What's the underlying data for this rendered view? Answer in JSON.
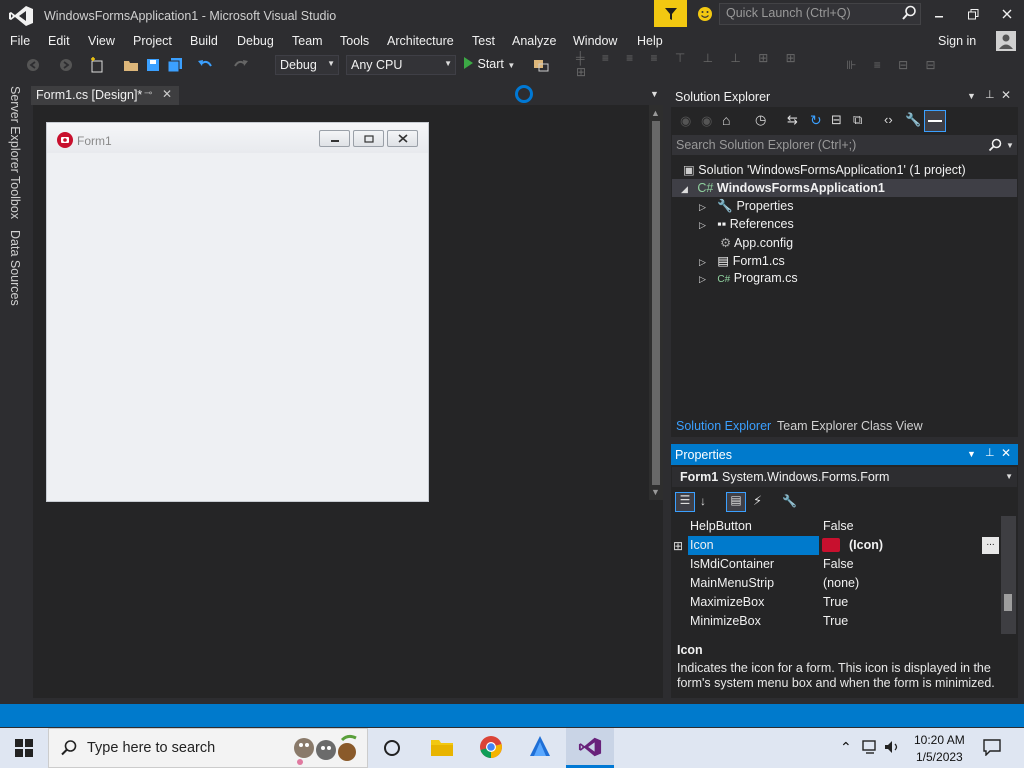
{
  "window": {
    "title": "WindowsFormsApplication1 - Microsoft Visual Studio",
    "quick_launch_placeholder": "Quick Launch (Ctrl+Q)"
  },
  "menu": {
    "items": [
      "File",
      "Edit",
      "View",
      "Project",
      "Build",
      "Debug",
      "Team",
      "Tools",
      "Architecture",
      "Test",
      "Analyze",
      "Window",
      "Help"
    ],
    "sign_in": "Sign in"
  },
  "toolbar": {
    "configuration": "Debug",
    "platform": "Any CPU",
    "start_label": "Start"
  },
  "left_rail": {
    "tabs": [
      "Server Explorer",
      "Toolbox",
      "Data Sources"
    ]
  },
  "document": {
    "tab_label": "Form1.cs [Design]*",
    "form_title": "Form1"
  },
  "solution_explorer": {
    "title": "Solution Explorer",
    "search_placeholder": "Search Solution Explorer (Ctrl+;)",
    "solution_label": "Solution 'WindowsFormsApplication1' (1 project)",
    "project_label": "WindowsFormsApplication1",
    "items": [
      "Properties",
      "References",
      "App.config",
      "Form1.cs",
      "Program.cs"
    ],
    "bottom_tabs": [
      "Solution Explorer",
      "Team Explorer",
      "Class View"
    ]
  },
  "properties": {
    "title": "Properties",
    "object_name": "Form1",
    "object_type": "System.Windows.Forms.Form",
    "rows": [
      {
        "name": "HelpButton",
        "value": "False"
      },
      {
        "name": "Icon",
        "value": "(Icon)"
      },
      {
        "name": "IsMdiContainer",
        "value": "False"
      },
      {
        "name": "MainMenuStrip",
        "value": "(none)"
      },
      {
        "name": "MaximizeBox",
        "value": "True"
      },
      {
        "name": "MinimizeBox",
        "value": "True"
      }
    ],
    "description_title": "Icon",
    "description_text": "Indicates the icon for a form. This icon is displayed in the form's system menu box and when the form is minimized."
  },
  "taskbar": {
    "search_placeholder": "Type here to search",
    "time": "10:20 AM",
    "date": "1/5/2023"
  },
  "colors": {
    "accent": "#007acc",
    "editor_bg": "#2d2d30",
    "notification": "#f2c811"
  }
}
